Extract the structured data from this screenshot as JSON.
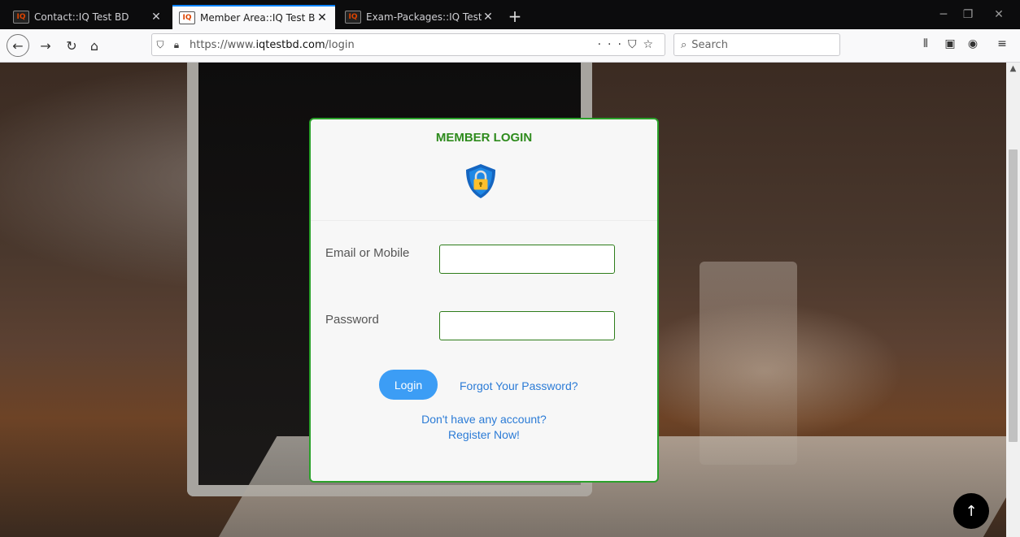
{
  "browser": {
    "tabs": [
      {
        "title": "Contact::IQ Test BD",
        "active": false
      },
      {
        "title": "Member Area::IQ Test BD",
        "active": true
      },
      {
        "title": "Exam-Packages::IQ Test BD",
        "active": false
      }
    ],
    "favicon_text": "IQ",
    "url_prefix": "https://www.",
    "url_domain": "iqtestbd.com",
    "url_path": "/login",
    "search_placeholder": "Search",
    "accent_color": "#0a84ff"
  },
  "login": {
    "heading": "MEMBER LOGIN",
    "email_label": "Email or Mobile",
    "email_value": "",
    "password_label": "Password",
    "password_value": "",
    "login_button": "Login",
    "forgot_link": "Forgot Your Password?",
    "no_account_text": "Don't have any account?",
    "register_link": "Register Now!",
    "heading_color": "#2e8b1d",
    "border_color": "#2aa12a",
    "button_color": "#3c9df5"
  }
}
